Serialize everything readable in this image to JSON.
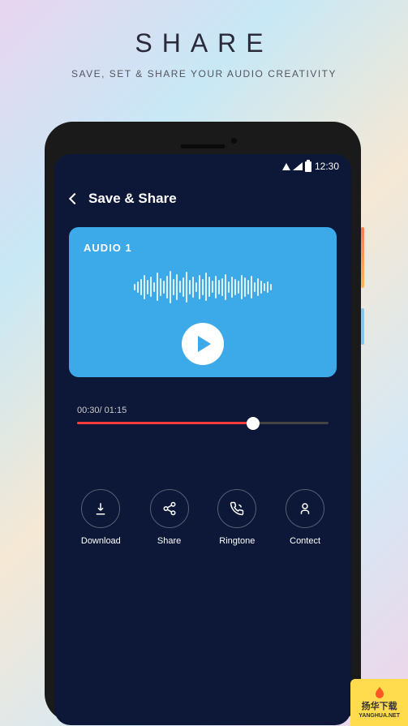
{
  "header": {
    "title": "SHARE",
    "subtitle": "SAVE, SET & SHARE YOUR AUDIO CREATIVITY"
  },
  "statusBar": {
    "time": "12:30"
  },
  "screen": {
    "title": "Save & Share"
  },
  "audio": {
    "label": "AUDIO 1",
    "currentTime": "00:30",
    "totalTime": "01:15",
    "progressPercent": 70
  },
  "actions": [
    {
      "label": "Download",
      "icon": "download-icon"
    },
    {
      "label": "Share",
      "icon": "share-icon"
    },
    {
      "label": "Ringtone",
      "icon": "ringtone-icon"
    },
    {
      "label": "Contect",
      "icon": "contact-icon"
    }
  ],
  "badge": {
    "line1": "扬华下载",
    "line2": "YANGHUA.NET"
  }
}
